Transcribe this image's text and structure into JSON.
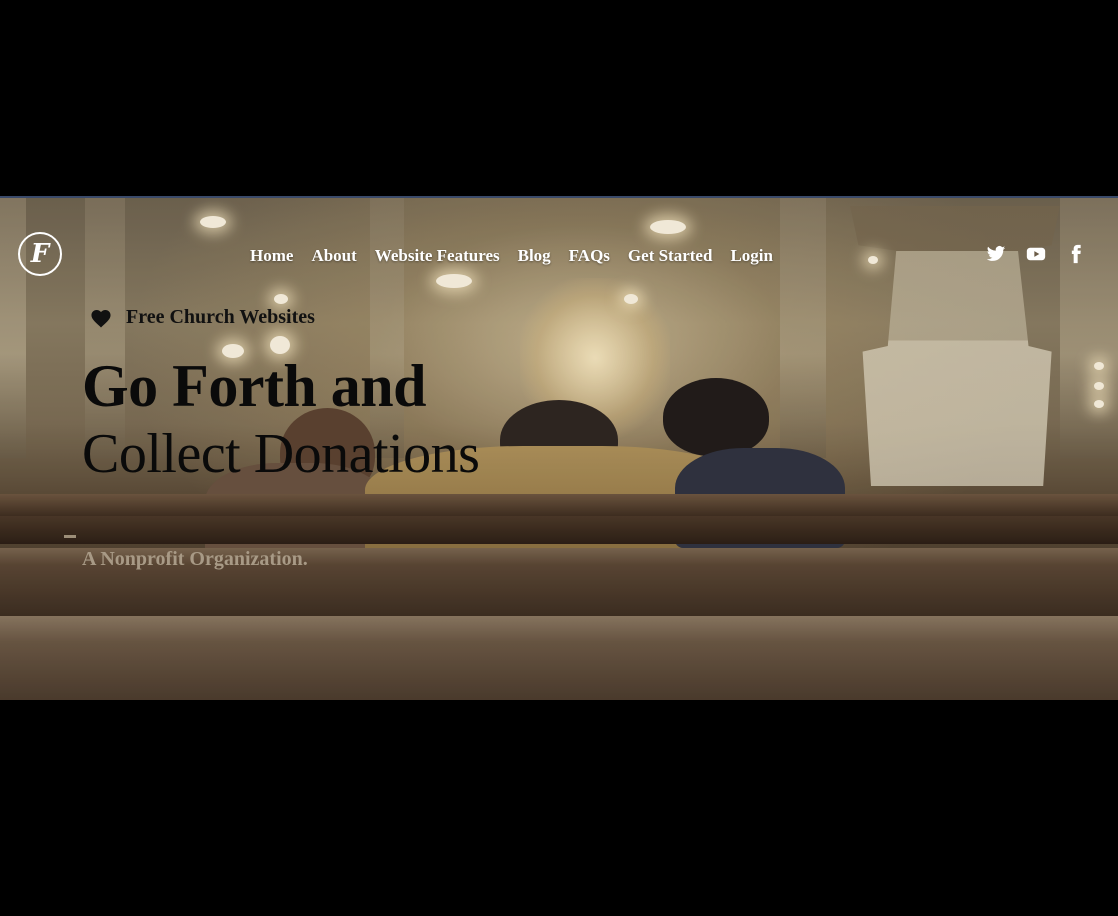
{
  "header": {
    "logo_letter": "F",
    "nav": [
      "Home",
      "About",
      "Website Features",
      "Blog",
      "FAQs",
      "Get Started",
      "Login"
    ],
    "social": [
      "twitter-icon",
      "youtube-icon",
      "facebook-icon"
    ]
  },
  "hero": {
    "tagline": "Free Church Websites",
    "headline_bold": "Go Forth and",
    "headline_regular": "Collect Donations",
    "subtitle": "A Nonprofit Organization."
  },
  "colors": {
    "nav_text": "#ffffff",
    "headline": "#0a0a0a",
    "subtitle": "#a89a86",
    "letterbox": "#000000"
  }
}
